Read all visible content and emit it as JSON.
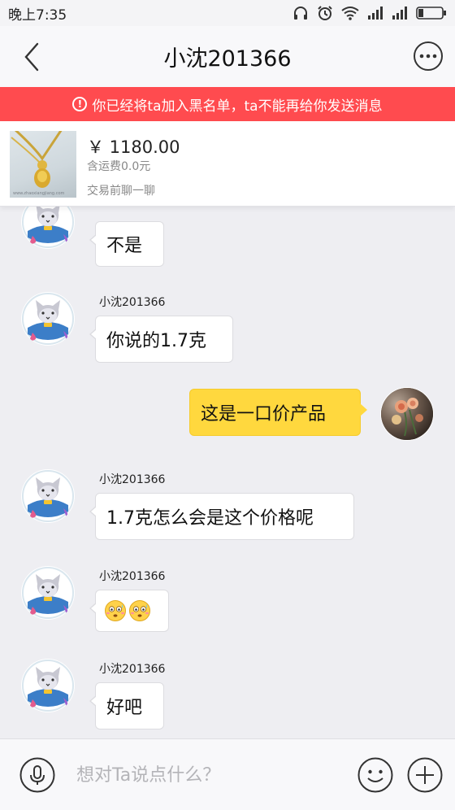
{
  "status_bar": {
    "time": "晚上7:35",
    "icons": [
      "headphones-icon",
      "alarm-icon",
      "wifi-icon",
      "signal-icon",
      "signal-icon",
      "battery-icon"
    ]
  },
  "header": {
    "title": "小沈201366",
    "back_icon": "chevron-left-icon",
    "more_icon": "more-dots-icon"
  },
  "warning": {
    "text": "你已经将ta加入黑名单，ta不能再给你发送消息",
    "icon": "exclamation-circle-icon",
    "color": "#ff4b4f"
  },
  "product": {
    "price": "￥ 1180.00",
    "shipping": "含运费0.0元",
    "chat_prompt": "交易前聊一聊",
    "thumb_watermark": "www.zhaoxiangjiang.com"
  },
  "messages": [
    {
      "from": "other",
      "sender": "",
      "text": "不是"
    },
    {
      "from": "other",
      "sender": "小沈201366",
      "text": "你说的1.7克"
    },
    {
      "from": "me",
      "sender": "",
      "text": "这是一口价产品"
    },
    {
      "from": "other",
      "sender": "小沈201366",
      "text": "1.7克怎么会是这个价格呢"
    },
    {
      "from": "other",
      "sender": "小沈201366",
      "text": "",
      "emojis": [
        "worried-face-icon",
        "worried-face-icon"
      ]
    },
    {
      "from": "other",
      "sender": "小沈201366",
      "text": "好吧"
    }
  ],
  "input_bar": {
    "placeholder": "想对Ta说点什么？",
    "mic_icon": "microphone-icon",
    "emoji_icon": "smiley-icon",
    "plus_icon": "plus-icon"
  },
  "colors": {
    "my_bubble": "#ffd83e",
    "warning_bg": "#ff4b4f",
    "chat_bg": "#eeeef2"
  }
}
